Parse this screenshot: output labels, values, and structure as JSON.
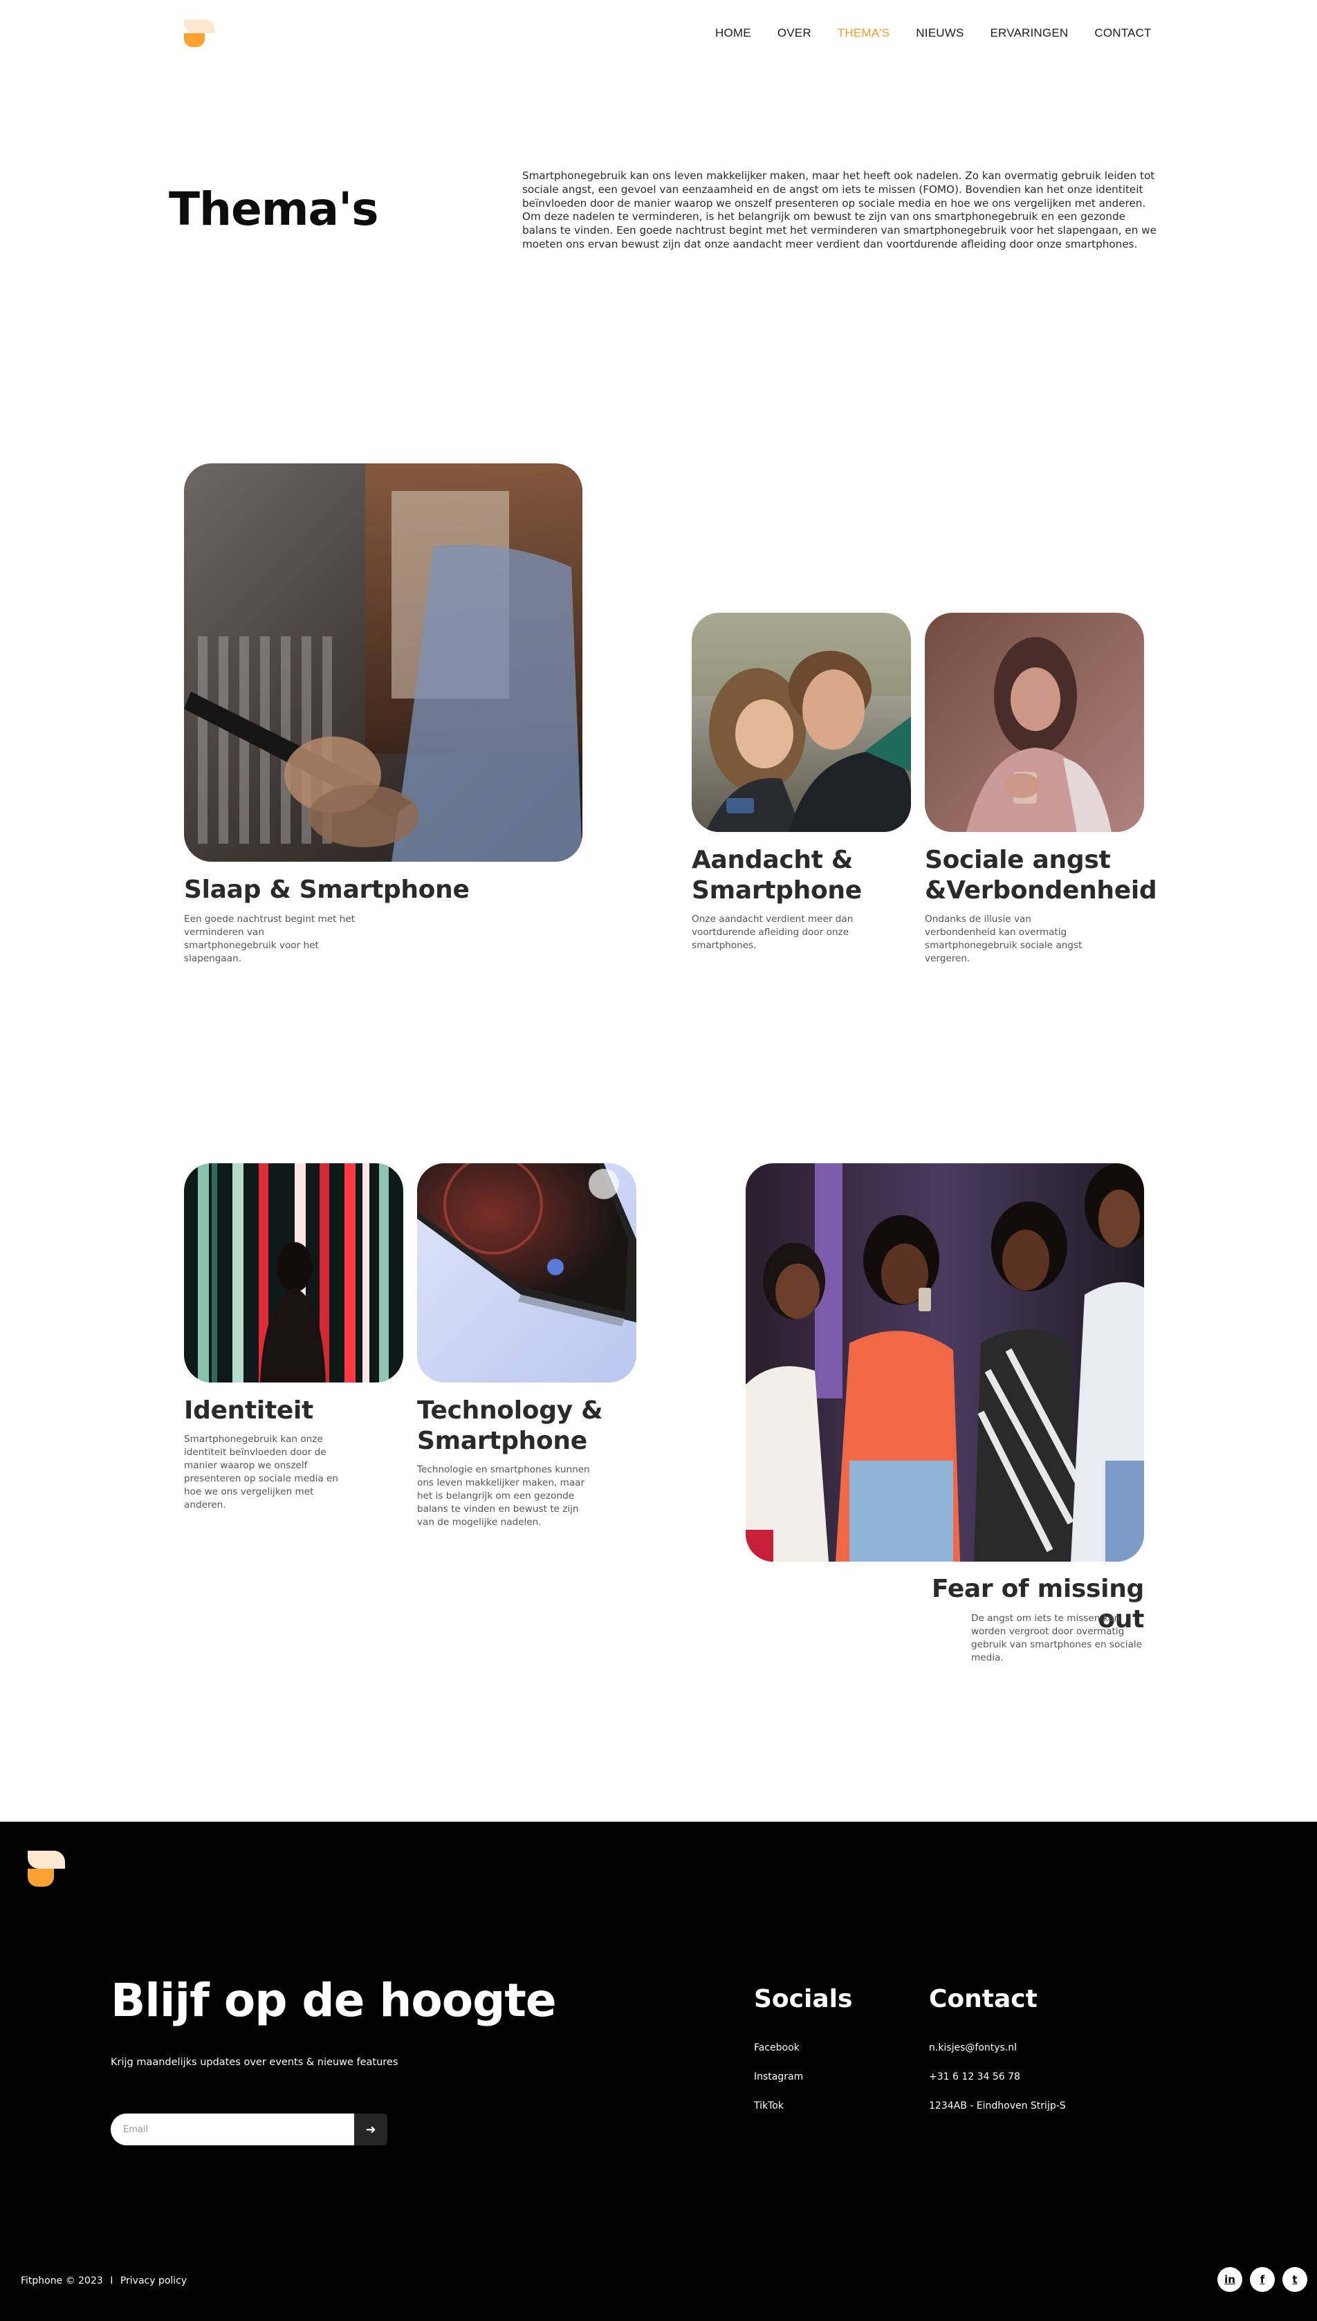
{
  "header": {
    "logo": "fitphone-logo",
    "nav": [
      {
        "label": "HOME",
        "active": false
      },
      {
        "label": "OVER",
        "active": false
      },
      {
        "label": "THEMA'S",
        "active": true
      },
      {
        "label": "NIEUWS",
        "active": false
      },
      {
        "label": "ERVARINGEN",
        "active": false
      },
      {
        "label": "CONTACT",
        "active": false
      }
    ]
  },
  "intro": {
    "title": "Thema's",
    "text": "Smartphonegebruik kan ons leven makkelijker maken, maar het heeft ook nadelen. Zo kan overmatig gebruik leiden tot sociale angst, een gevoel van eenzaamheid en de angst om iets te missen (FOMO). Bovendien kan het onze identiteit beïnvloeden door de manier waarop we onszelf presenteren op sociale media en hoe we ons vergelijken met anderen. Om deze nadelen te verminderen, is het belangrijk om bewust te zijn van ons smartphonegebruik en een gezonde balans te vinden. Een goede nachtrust begint met het verminderen van smartphonegebruik voor het slapengaan, en we moeten ons ervan bewust zijn dat onze aandacht meer verdient dan voortdurende afleiding door onze smartphones."
  },
  "themes": [
    {
      "title": "Slaap & Smartphone",
      "text": "Een goede nachtrust begint met het verminderen van smartphonegebruik voor het slapengaan."
    },
    {
      "title": "Aandacht & Smartphone",
      "text": "Onze aandacht verdient meer dan voortdurende afleiding door onze smartphones."
    },
    {
      "title": "Sociale angst &Verbondenheid",
      "text": "Ondanks de illusie van verbondenheid kan overmatig smartphonegebruik sociale angst vergeren."
    },
    {
      "title": "Identiteit",
      "text": "Smartphonegebruik kan onze identiteit beïnvloeden door de manier waarop we onszelf presenteren op sociale media en hoe we ons vergelijken met anderen."
    },
    {
      "title": "Technology & Smartphone",
      "text": "Technologie en smartphones kunnen ons leven makkelijker maken, maar het is belangrijk om een gezonde balans te vinden en bewust te zijn van de mogelijke nadelen."
    },
    {
      "title": "Fear of missing out",
      "text": "De angst om iets te missen kan worden vergroot door overmatig gebruik van smartphones en sociale media."
    }
  ],
  "footer": {
    "heading": "Blijf op de hoogte",
    "subtext": "Krijg maandelijks updates over events & nieuwe features",
    "email_placeholder": "Email",
    "submit_icon": "arrow-right-icon",
    "socials_heading": "Socials",
    "socials": [
      "Facebook",
      "Instagram",
      "TikTok"
    ],
    "contact_heading": "Contact",
    "contact": [
      "n.kisjes@fontys.nl",
      "+31 6 12 34 56 78",
      "1234AB - Eindhoven Strijp-S"
    ],
    "copyright": "Fitphone © 2023",
    "separator": "I",
    "privacy": "Privacy policy",
    "social_icons": [
      {
        "icon": "linkedin-icon",
        "glyph": "in"
      },
      {
        "icon": "facebook-icon",
        "glyph": "f"
      },
      {
        "icon": "twitter-icon",
        "glyph": "t"
      }
    ]
  },
  "colors": {
    "accent": "#f39a2e",
    "logo_light": "#fde7d0",
    "logo_dark": "#f7a233",
    "footer_bg": "#020202"
  }
}
